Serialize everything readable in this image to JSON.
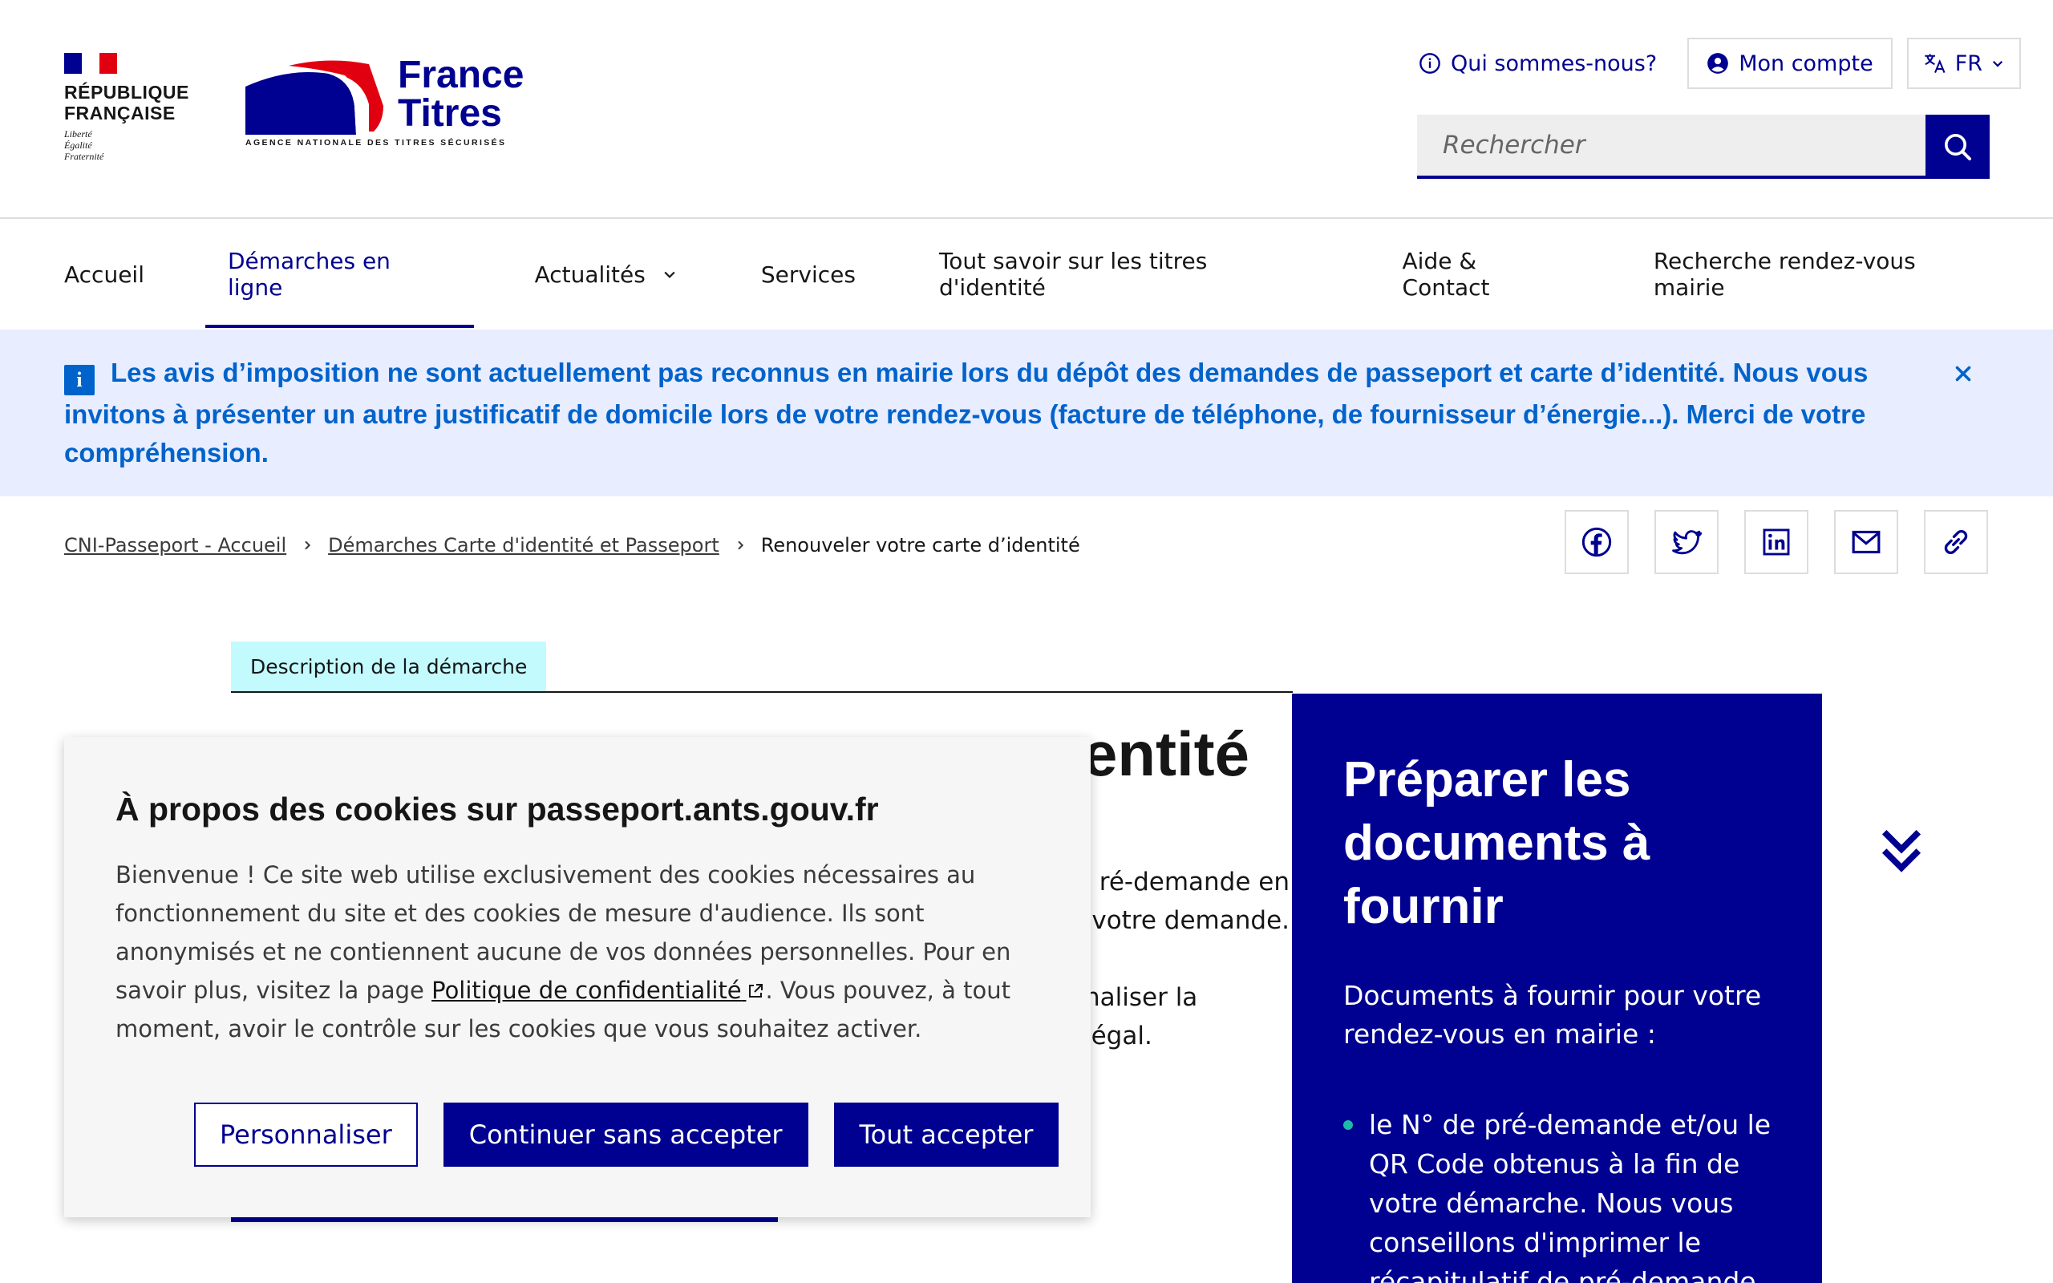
{
  "header": {
    "republique": {
      "line1": "RÉPUBLIQUE",
      "line2": "FRANÇAISE",
      "motto": [
        "Liberté",
        "Égalité",
        "Fraternité"
      ],
      "flag_colors": [
        "#000091",
        "#ffffff",
        "#e1000f"
      ]
    },
    "brand": {
      "name_line1": "France",
      "name_line2": "Titres",
      "tagline": "AGENCE NATIONALE DES TITRES SÉCURISÉS",
      "colors": {
        "blue": "#000091",
        "red": "#e1000f"
      }
    },
    "tools": {
      "about": "Qui sommes-nous?",
      "account": "Mon compte",
      "language": "FR"
    },
    "search": {
      "placeholder": "Rechercher"
    }
  },
  "nav": {
    "items": [
      {
        "label": "Accueil",
        "active": false
      },
      {
        "label": "Démarches en ligne",
        "active": true
      },
      {
        "label": "Actualités",
        "active": false,
        "dropdown": true
      },
      {
        "label": "Services",
        "active": false
      },
      {
        "label": "Tout savoir sur les titres d'identité",
        "active": false
      },
      {
        "label": "Aide & Contact",
        "active": false
      },
      {
        "label": "Recherche rendez-vous mairie",
        "active": false
      }
    ]
  },
  "notice": {
    "icon": "info-icon",
    "text": "Les avis d’imposition ne sont actuellement pas reconnus en mairie lors du dépôt des demandes de passeport et carte d’identité. Nous vous invitons à présenter un autre justificatif de domicile lors de votre rendez-vous (facture de téléphone, de fournisseur d’énergie...). Merci de votre compréhension.",
    "colors": {
      "background": "#e8edff",
      "text": "#0063cb"
    }
  },
  "breadcrumb": {
    "items": [
      "CNI-Passeport - Accueil",
      "Démarches Carte d'identité et Passeport"
    ],
    "current": "Renouveler votre carte d’identité"
  },
  "share": [
    "facebook-icon",
    "twitter-icon",
    "linkedin-icon",
    "mail-icon",
    "link-icon"
  ],
  "main": {
    "tag": "Description de la démarche",
    "title_visible": "entité",
    "paragraph1_line1": "ré-demande en",
    "paragraph1_line2": "votre demande.",
    "paragraph2_line1": "naliser la",
    "paragraph2_line2": "légal."
  },
  "side_card": {
    "title": "Préparer les documents à fournir",
    "intro": "Documents à fournir pour votre rendez-vous en mairie :",
    "list": [
      "le N° de pré-demande et/ou le QR Code obtenus à la fin de votre démarche. Nous vous conseillons d'imprimer le récapitulatif de pré-demande"
    ],
    "bullet_color": "#1ebaa6"
  },
  "cookie": {
    "title": "À propos des cookies sur passeport.ants.gouv.fr",
    "text_before": "Bienvenue ! Ce site web utilise exclusivement des cookies nécessaires au fonctionnement du site et des cookies de mesure d'audience. Ils sont anonymisés et ne contiennent aucune de vos données personnelles. Pour en savoir plus, visitez la page ",
    "link": "Politique de confidentialité",
    "text_after": ". Vous pouvez, à tout moment, avoir le contrôle sur les cookies que vous souhaitez activer.",
    "buttons": {
      "customize": "Personnaliser",
      "reject": "Continuer sans accepter",
      "accept": "Tout accepter"
    }
  }
}
